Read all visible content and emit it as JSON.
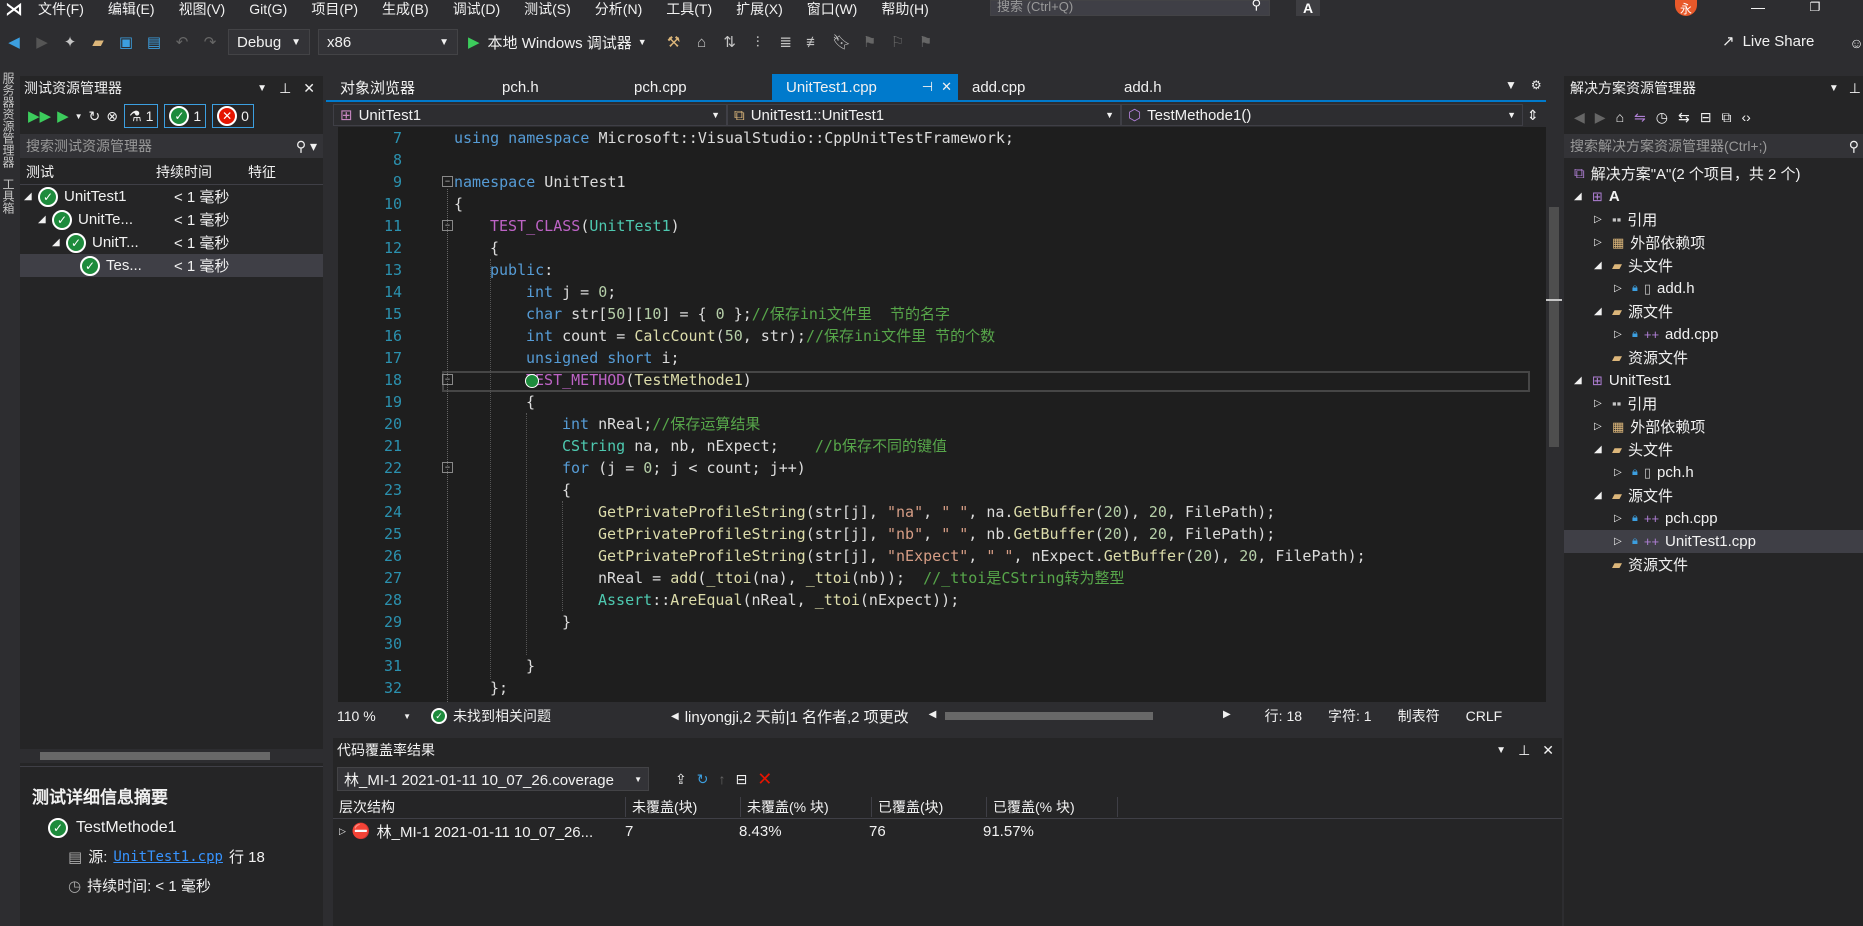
{
  "menu": {
    "items": [
      "文件(F)",
      "编辑(E)",
      "视图(V)",
      "Git(G)",
      "项目(P)",
      "生成(B)",
      "调试(D)",
      "测试(S)",
      "分析(N)",
      "工具(T)",
      "扩展(X)",
      "窗口(W)",
      "帮助(H)"
    ],
    "search_placeholder": "搜索 (Ctrl+Q)",
    "avatar_letter": "A",
    "user_letter": "永"
  },
  "toolbar": {
    "config": "Debug",
    "platform": "x86",
    "debugger": "本地 Windows 调试器",
    "live_share": "Live Share"
  },
  "left_strip": {
    "label1": "服务器资源管理器",
    "label2": "工具箱"
  },
  "test_explorer": {
    "title": "测试资源管理器",
    "counts": {
      "total": "1",
      "passed": "1",
      "failed": "0"
    },
    "search_placeholder": "搜索测试资源管理器",
    "columns": [
      "测试",
      "持续时间",
      "特征"
    ],
    "rows": [
      {
        "name": "UnitTest1",
        "duration": "< 1 毫秒"
      },
      {
        "name": "UnitTe...",
        "duration": "< 1 毫秒"
      },
      {
        "name": "UnitT...",
        "duration": "< 1 毫秒"
      },
      {
        "name": "Tes...",
        "duration": "< 1 毫秒"
      }
    ],
    "summary_title": "测试详细信息摘要",
    "summary_test": "TestMethode1",
    "source_label": "源:",
    "source_file": "UnitTest1.cpp",
    "source_line": "行 18",
    "duration_label": "持续时间: < 1 毫秒"
  },
  "tabs": [
    {
      "label": "对象浏览器",
      "active": false
    },
    {
      "label": "pch.h",
      "active": false
    },
    {
      "label": "pch.cpp",
      "active": false
    },
    {
      "label": "UnitTest1.cpp",
      "active": true
    },
    {
      "label": "add.cpp",
      "active": false
    },
    {
      "label": "add.h",
      "active": false
    }
  ],
  "nav_bar": {
    "project": "UnitTest1",
    "scope": "UnitTest1::UnitTest1",
    "member": "TestMethode1()"
  },
  "code": {
    "line_numbers": [
      "7",
      "8",
      "9",
      "10",
      "11",
      "12",
      "13",
      "14",
      "15",
      "16",
      "17",
      "18",
      "19",
      "20",
      "21",
      "22",
      "23",
      "24",
      "25",
      "26",
      "27",
      "28",
      "29",
      "30",
      "31",
      "32"
    ]
  },
  "status": {
    "zoom": "110 %",
    "issues": "未找到相关问题",
    "git": "linyongji,2 天前|1 名作者,2 项更改",
    "line": "行: 18",
    "col": "字符: 1",
    "tabs": "制表符",
    "eol": "CRLF"
  },
  "coverage": {
    "title": "代码覆盖率结果",
    "file": "林_MI-1 2021-01-11 10_07_26.coverage",
    "columns": [
      "层次结构",
      "未覆盖(块)",
      "未覆盖(% 块)",
      "已覆盖(块)",
      "已覆盖(% 块)"
    ],
    "rows": [
      {
        "name": "林_MI-1 2021-01-11 10_07_26...",
        "uncovered": "7",
        "uncovered_pct": "8.43%",
        "covered": "76",
        "covered_pct": "91.57%"
      }
    ]
  },
  "solution": {
    "title": "解决方案资源管理器",
    "search_placeholder": "搜索解决方案资源管理器(Ctrl+;)",
    "root": "解决方案\"A\"(2 个项目，共 2 个)",
    "nodes": [
      {
        "label": "A",
        "depth": 1
      },
      {
        "label": "引用",
        "depth": 2
      },
      {
        "label": "外部依赖项",
        "depth": 2
      },
      {
        "label": "头文件",
        "depth": 2
      },
      {
        "label": "add.h",
        "depth": 3
      },
      {
        "label": "源文件",
        "depth": 2
      },
      {
        "label": "add.cpp",
        "depth": 3
      },
      {
        "label": "资源文件",
        "depth": 2
      },
      {
        "label": "UnitTest1",
        "depth": 1
      },
      {
        "label": "引用",
        "depth": 2
      },
      {
        "label": "外部依赖项",
        "depth": 2
      },
      {
        "label": "头文件",
        "depth": 2
      },
      {
        "label": "pch.h",
        "depth": 3
      },
      {
        "label": "源文件",
        "depth": 2
      },
      {
        "label": "pch.cpp",
        "depth": 3
      },
      {
        "label": "UnitTest1.cpp",
        "depth": 3
      },
      {
        "label": "资源文件",
        "depth": 2
      }
    ]
  },
  "colors": {
    "accent": "#007acc",
    "pass": "#1d8b3c",
    "fail": "#e51400",
    "line_number": "#2b91af"
  }
}
